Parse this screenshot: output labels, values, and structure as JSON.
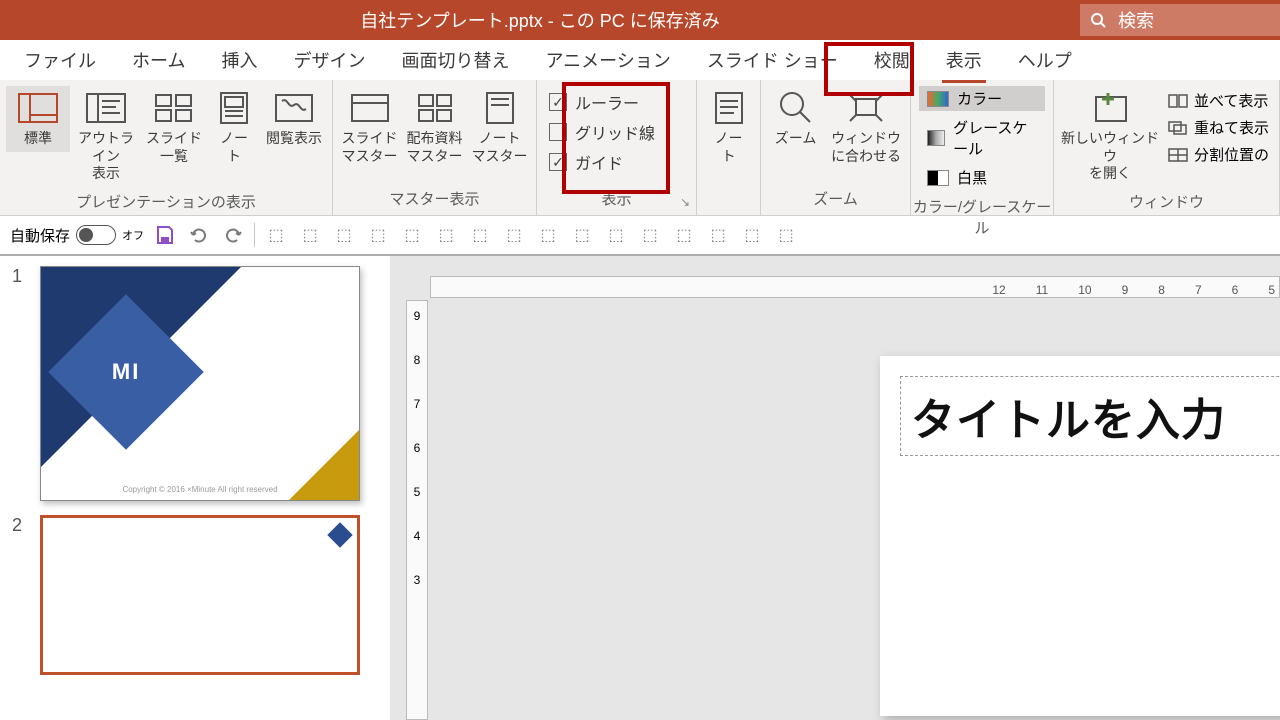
{
  "titlebar": {
    "title": "自社テンプレート.pptx - この PC に保存済み",
    "search_placeholder": "検索"
  },
  "tabs": {
    "file": "ファイル",
    "home": "ホーム",
    "insert": "挿入",
    "design": "デザイン",
    "transitions": "画面切り替え",
    "animations": "アニメーション",
    "slideshow": "スライド ショー",
    "review": "校閲",
    "view": "表示",
    "help": "ヘルプ"
  },
  "ribbon": {
    "presentation_views": {
      "label": "プレゼンテーションの表示",
      "normal": "標準",
      "outline": "アウトライン\n表示",
      "sorter": "スライド\n一覧",
      "notes": "ノー\nト",
      "reading": "閲覧表示"
    },
    "master_views": {
      "label": "マスター表示",
      "slide_master": "スライド\nマスター",
      "handout_master": "配布資料\nマスター",
      "notes_master": "ノート\nマスター"
    },
    "show": {
      "label": "表示",
      "ruler": "ルーラー",
      "gridlines": "グリッド線",
      "guides": "ガイド",
      "ruler_checked": true,
      "gridlines_checked": false,
      "guides_checked": true
    },
    "notes_group": {
      "notes": "ノー\nト"
    },
    "zoom": {
      "label": "ズーム",
      "zoom_btn": "ズーム",
      "fit": "ウィンドウ\nに合わせる"
    },
    "color_gray": {
      "label": "カラー/グレースケール",
      "color": "カラー",
      "grayscale": "グレースケール",
      "bw": "白黒"
    },
    "window": {
      "label": "ウィンドウ",
      "new_window": "新しいウィンドウ\nを開く",
      "arrange": "並べて表示",
      "cascade": "重ねて表示",
      "split": "分割位置の"
    }
  },
  "qat": {
    "autosave": "自動保存",
    "autosave_state": "オフ"
  },
  "thumbnails": {
    "s1": {
      "num": "1",
      "logo": "MI",
      "footer": "Copyright © 2016 ×Minute All right reserved"
    },
    "s2": {
      "num": "2"
    }
  },
  "canvas": {
    "title_placeholder": "タイトルを入力"
  },
  "rulers": {
    "h": [
      "12",
      "11",
      "10",
      "9",
      "8",
      "7",
      "6",
      "5"
    ],
    "v": [
      "9",
      "8",
      "7",
      "6",
      "5",
      "4",
      "3"
    ]
  }
}
